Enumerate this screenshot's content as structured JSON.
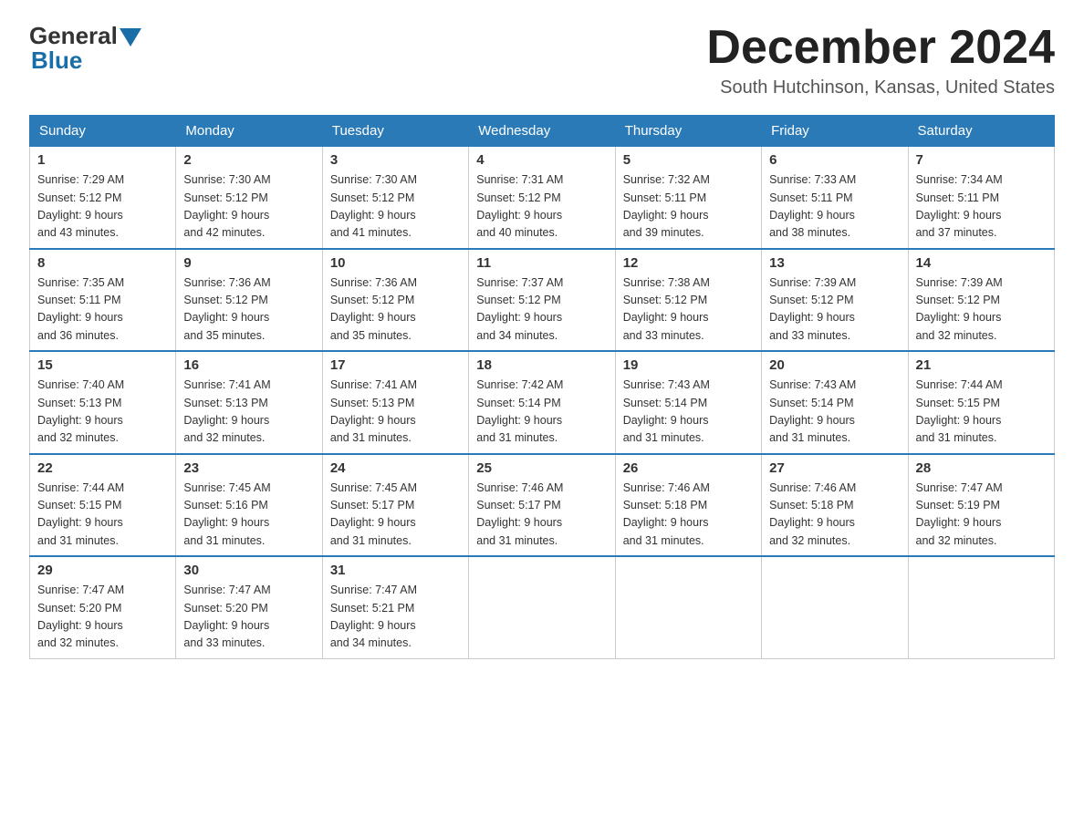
{
  "header": {
    "logo_general": "General",
    "logo_blue": "Blue",
    "month_title": "December 2024",
    "location": "South Hutchinson, Kansas, United States"
  },
  "days_of_week": [
    "Sunday",
    "Monday",
    "Tuesday",
    "Wednesday",
    "Thursday",
    "Friday",
    "Saturday"
  ],
  "weeks": [
    [
      {
        "day": "1",
        "sunrise": "7:29 AM",
        "sunset": "5:12 PM",
        "daylight": "9 hours and 43 minutes."
      },
      {
        "day": "2",
        "sunrise": "7:30 AM",
        "sunset": "5:12 PM",
        "daylight": "9 hours and 42 minutes."
      },
      {
        "day": "3",
        "sunrise": "7:30 AM",
        "sunset": "5:12 PM",
        "daylight": "9 hours and 41 minutes."
      },
      {
        "day": "4",
        "sunrise": "7:31 AM",
        "sunset": "5:12 PM",
        "daylight": "9 hours and 40 minutes."
      },
      {
        "day": "5",
        "sunrise": "7:32 AM",
        "sunset": "5:11 PM",
        "daylight": "9 hours and 39 minutes."
      },
      {
        "day": "6",
        "sunrise": "7:33 AM",
        "sunset": "5:11 PM",
        "daylight": "9 hours and 38 minutes."
      },
      {
        "day": "7",
        "sunrise": "7:34 AM",
        "sunset": "5:11 PM",
        "daylight": "9 hours and 37 minutes."
      }
    ],
    [
      {
        "day": "8",
        "sunrise": "7:35 AM",
        "sunset": "5:11 PM",
        "daylight": "9 hours and 36 minutes."
      },
      {
        "day": "9",
        "sunrise": "7:36 AM",
        "sunset": "5:12 PM",
        "daylight": "9 hours and 35 minutes."
      },
      {
        "day": "10",
        "sunrise": "7:36 AM",
        "sunset": "5:12 PM",
        "daylight": "9 hours and 35 minutes."
      },
      {
        "day": "11",
        "sunrise": "7:37 AM",
        "sunset": "5:12 PM",
        "daylight": "9 hours and 34 minutes."
      },
      {
        "day": "12",
        "sunrise": "7:38 AM",
        "sunset": "5:12 PM",
        "daylight": "9 hours and 33 minutes."
      },
      {
        "day": "13",
        "sunrise": "7:39 AM",
        "sunset": "5:12 PM",
        "daylight": "9 hours and 33 minutes."
      },
      {
        "day": "14",
        "sunrise": "7:39 AM",
        "sunset": "5:12 PM",
        "daylight": "9 hours and 32 minutes."
      }
    ],
    [
      {
        "day": "15",
        "sunrise": "7:40 AM",
        "sunset": "5:13 PM",
        "daylight": "9 hours and 32 minutes."
      },
      {
        "day": "16",
        "sunrise": "7:41 AM",
        "sunset": "5:13 PM",
        "daylight": "9 hours and 32 minutes."
      },
      {
        "day": "17",
        "sunrise": "7:41 AM",
        "sunset": "5:13 PM",
        "daylight": "9 hours and 31 minutes."
      },
      {
        "day": "18",
        "sunrise": "7:42 AM",
        "sunset": "5:14 PM",
        "daylight": "9 hours and 31 minutes."
      },
      {
        "day": "19",
        "sunrise": "7:43 AM",
        "sunset": "5:14 PM",
        "daylight": "9 hours and 31 minutes."
      },
      {
        "day": "20",
        "sunrise": "7:43 AM",
        "sunset": "5:14 PM",
        "daylight": "9 hours and 31 minutes."
      },
      {
        "day": "21",
        "sunrise": "7:44 AM",
        "sunset": "5:15 PM",
        "daylight": "9 hours and 31 minutes."
      }
    ],
    [
      {
        "day": "22",
        "sunrise": "7:44 AM",
        "sunset": "5:15 PM",
        "daylight": "9 hours and 31 minutes."
      },
      {
        "day": "23",
        "sunrise": "7:45 AM",
        "sunset": "5:16 PM",
        "daylight": "9 hours and 31 minutes."
      },
      {
        "day": "24",
        "sunrise": "7:45 AM",
        "sunset": "5:17 PM",
        "daylight": "9 hours and 31 minutes."
      },
      {
        "day": "25",
        "sunrise": "7:46 AM",
        "sunset": "5:17 PM",
        "daylight": "9 hours and 31 minutes."
      },
      {
        "day": "26",
        "sunrise": "7:46 AM",
        "sunset": "5:18 PM",
        "daylight": "9 hours and 31 minutes."
      },
      {
        "day": "27",
        "sunrise": "7:46 AM",
        "sunset": "5:18 PM",
        "daylight": "9 hours and 32 minutes."
      },
      {
        "day": "28",
        "sunrise": "7:47 AM",
        "sunset": "5:19 PM",
        "daylight": "9 hours and 32 minutes."
      }
    ],
    [
      {
        "day": "29",
        "sunrise": "7:47 AM",
        "sunset": "5:20 PM",
        "daylight": "9 hours and 32 minutes."
      },
      {
        "day": "30",
        "sunrise": "7:47 AM",
        "sunset": "5:20 PM",
        "daylight": "9 hours and 33 minutes."
      },
      {
        "day": "31",
        "sunrise": "7:47 AM",
        "sunset": "5:21 PM",
        "daylight": "9 hours and 34 minutes."
      },
      null,
      null,
      null,
      null
    ]
  ],
  "labels": {
    "sunrise": "Sunrise:",
    "sunset": "Sunset:",
    "daylight": "Daylight:"
  }
}
